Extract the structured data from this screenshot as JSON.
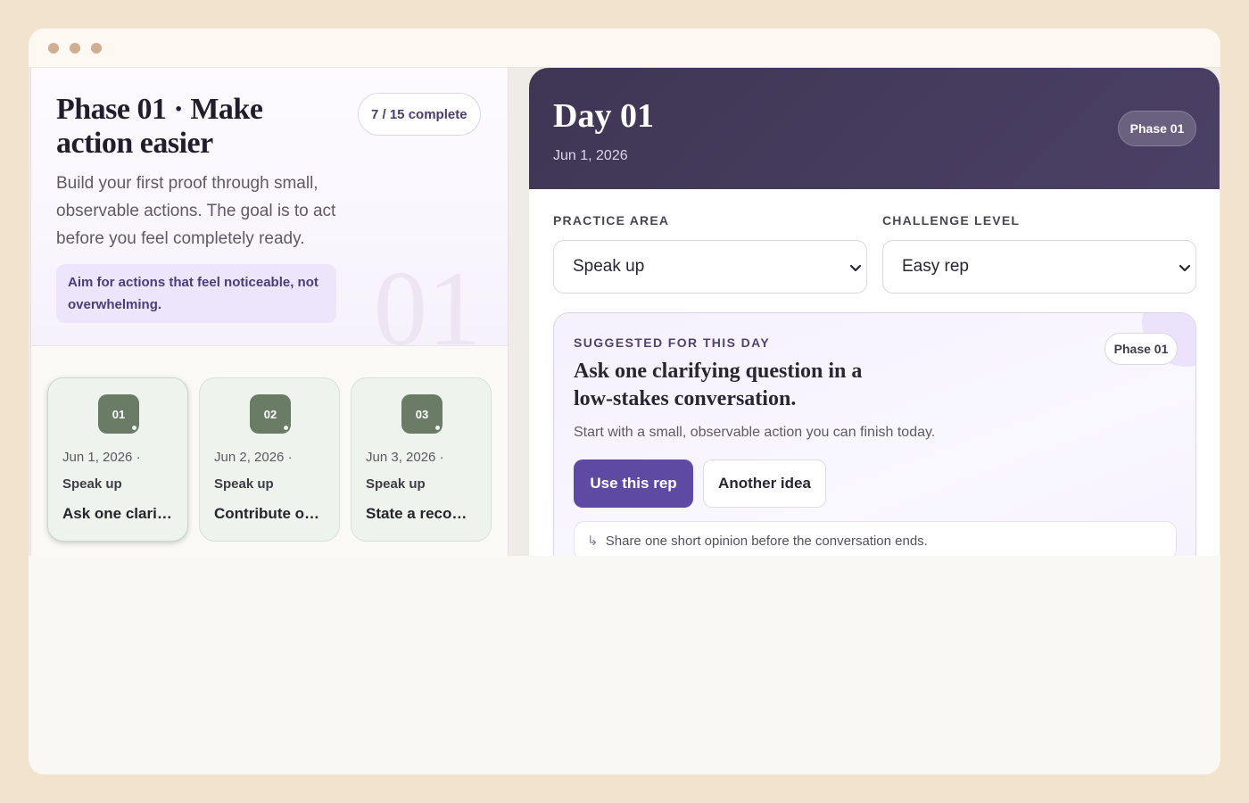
{
  "window": {
    "controls": [
      "close",
      "minimize",
      "maximize"
    ]
  },
  "phase": {
    "title": "Phase 01 · Make action easier",
    "progress": "7 / 15 complete",
    "description": "Build your first proof through small, observable actions. The goal is to act before you feel completely ready.",
    "tip": "Aim for actions that feel noticeable, not overwhelming.",
    "watermark": "01"
  },
  "days": [
    {
      "badge": "01",
      "date": "Jun 1, 2026 ·",
      "area": "Speak up",
      "title": "Ask one clarifying question in a low-stakes conversation."
    },
    {
      "badge": "02",
      "date": "Jun 2, 2026 ·",
      "area": "Speak up",
      "title": "Contribute one idea in a group setting."
    },
    {
      "badge": "03",
      "date": "Jun 3, 2026 ·",
      "area": "Speak up",
      "title": "State a recommendation clearly."
    }
  ],
  "detail": {
    "title": "Day 01",
    "date": "Jun 1, 2026",
    "phase_chip": "Phase 01",
    "practice_label": "PRACTICE AREA",
    "practice_value": "Speak up",
    "challenge_label": "CHALLENGE LEVEL",
    "challenge_value": "Easy rep"
  },
  "suggestion": {
    "label": "SUGGESTED FOR THIS DAY",
    "phase": "Phase 01",
    "title": "Ask one clarifying question in a low-stakes conversation.",
    "description": "Start with a small, observable action you can finish today.",
    "primary_button": "Use this rep",
    "secondary_button": "Another idea",
    "alternative": "Share one short opinion before the conversation ends."
  },
  "colors": {
    "accent": "#5f4aa3",
    "header": "#433a59",
    "badge": "#6a7c66",
    "background": "#f2e3cf"
  }
}
